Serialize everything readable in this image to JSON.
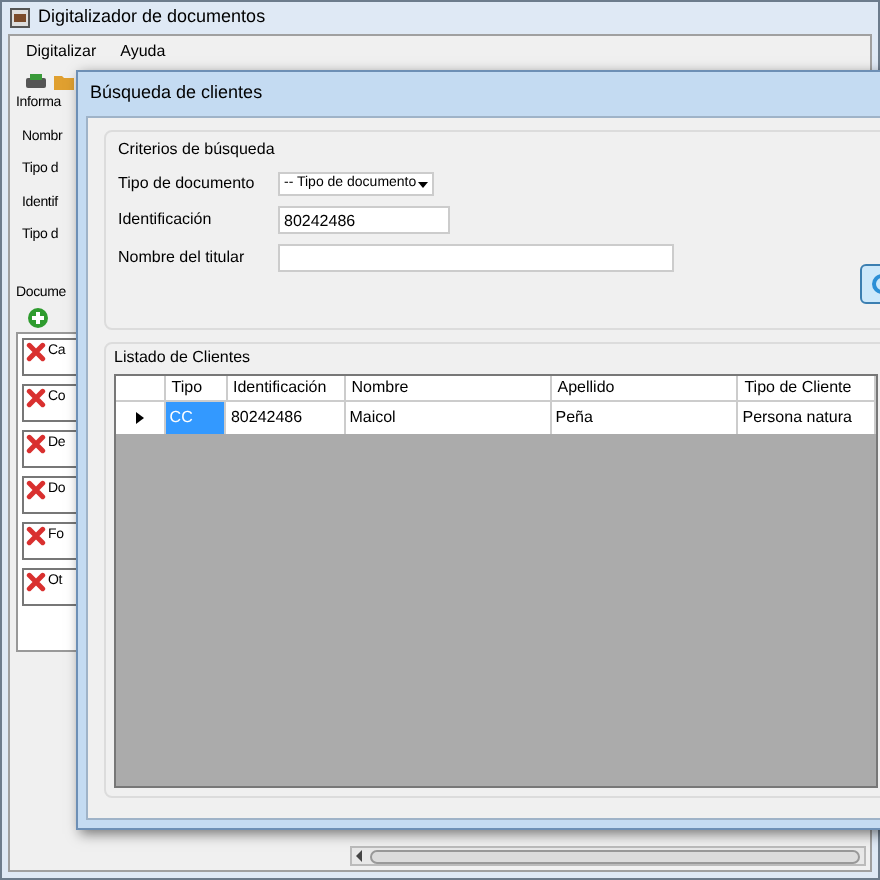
{
  "window": {
    "title": "Digitalizador de documentos"
  },
  "menu": [
    "Digitalizar",
    "Ayuda"
  ],
  "info_panel": {
    "title": "Informa",
    "labels": [
      "Nombr",
      "Tipo d",
      "Identif",
      "Tipo d"
    ]
  },
  "documents_panel": {
    "title": "Docume",
    "items": [
      "Ca",
      "Co",
      "De",
      "Do",
      "Fo",
      "Ot"
    ]
  },
  "dialog": {
    "title": "Búsqueda de clientes",
    "criteria": {
      "title": "Criterios de búsqueda",
      "document_type": {
        "label": "Tipo de documento",
        "value": "-- Tipo de documento"
      },
      "identification": {
        "label": "Identificación",
        "value": "80242486"
      },
      "holder_name": {
        "label": "Nombre del titular"
      }
    },
    "results": {
      "title": "Listado de Clientes",
      "columns": [
        "Tipo",
        "Identificación",
        "Nombre",
        "Apellido",
        "Tipo de Cliente"
      ],
      "rows": [
        {
          "current": true,
          "cells": [
            {
              "text": "CC",
              "selected": true
            },
            {
              "text": "80242486",
              "selected": false
            },
            {
              "text": "Maicol",
              "selected": false
            },
            {
              "text": "Peña",
              "selected": false
            },
            {
              "text": "Persona natura",
              "selected": false
            }
          ]
        }
      ]
    }
  }
}
